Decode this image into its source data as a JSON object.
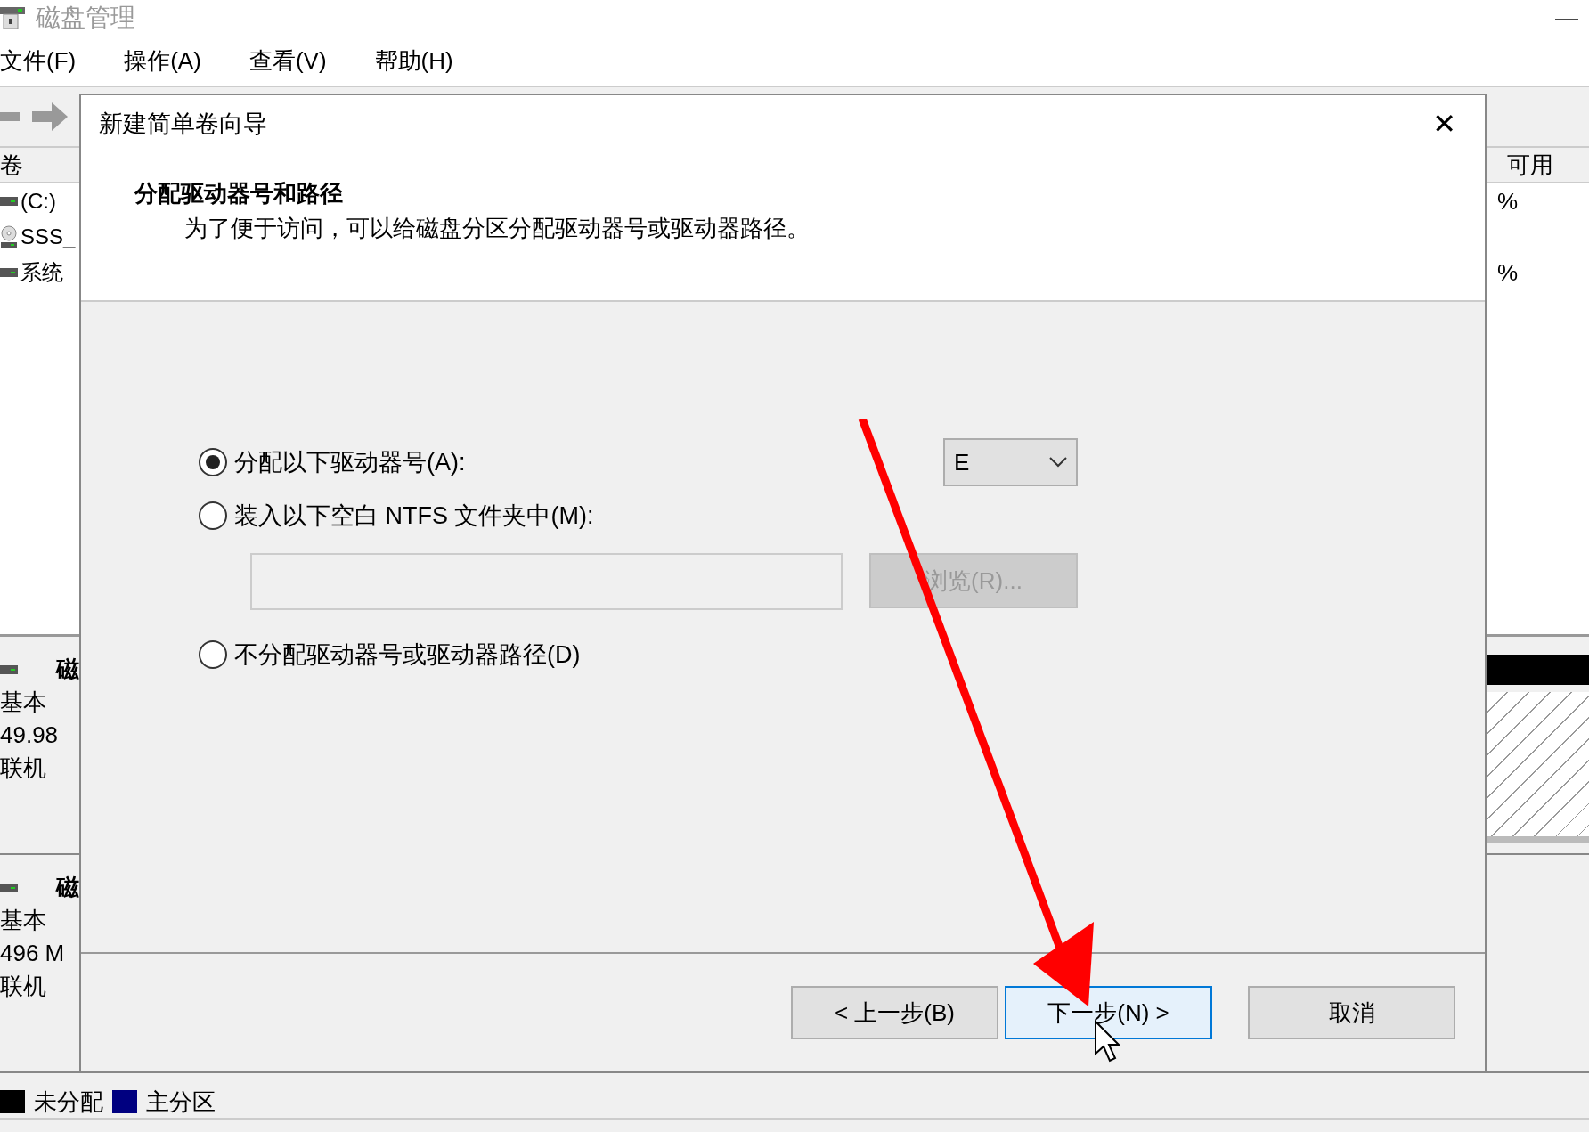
{
  "app": {
    "title": "磁盘管理",
    "minimize": "—",
    "menu": [
      {
        "label": "文件(F)"
      },
      {
        "label": "操作(A)"
      },
      {
        "label": "查看(V)"
      },
      {
        "label": "帮助(H)"
      }
    ],
    "volume_list": {
      "columns": [
        "卷",
        "可用"
      ],
      "rows": [
        {
          "kind": "drive",
          "column_1": "(C:)",
          "column_2": "%"
        },
        {
          "kind": "optical",
          "column_1": "SSS_"
        },
        {
          "kind": "drive",
          "column_1": "系统",
          "column_2": "%"
        }
      ]
    },
    "disks": [
      {
        "label": "磁",
        "type": "基本",
        "size": "49.98",
        "status": "联机",
        "unallocated": true
      },
      {
        "label": "磁",
        "type": "基本",
        "size": "496 M",
        "status": "联机",
        "unallocated": false
      }
    ],
    "legend": [
      {
        "label": "未分配",
        "color": "#000000"
      },
      {
        "label": "主分区",
        "color": "#000080"
      }
    ]
  },
  "dialog": {
    "title": "新建简单卷向导",
    "close": "✕",
    "heading": "分配驱动器号和路径",
    "subtitle": "为了便于访问，可以给磁盘分区分配驱动器号或驱动器路径。",
    "options": [
      {
        "label": "分配以下驱动器号(A):",
        "selected": true
      },
      {
        "label": "装入以下空白 NTFS 文件夹中(M):",
        "selected": false
      },
      {
        "label": "不分配驱动器号或驱动器路径(D)",
        "selected": false
      }
    ],
    "drive_letter": "E",
    "browse_button": {
      "label": "浏览(R)...",
      "disabled": true
    },
    "buttons": [
      {
        "label": "< 上一步(B)",
        "default": false
      },
      {
        "label": "下一步(N) >",
        "default": true
      },
      {
        "label": "取消",
        "default": false
      }
    ]
  }
}
